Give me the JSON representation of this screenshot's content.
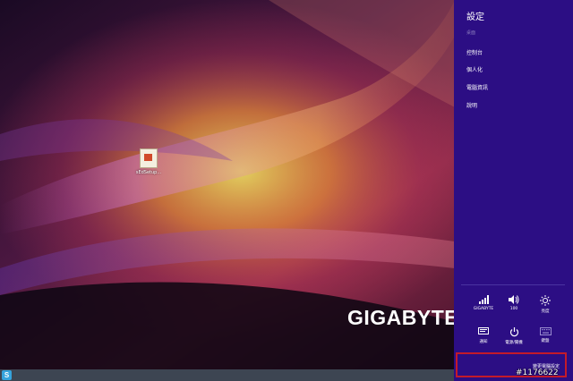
{
  "desktop": {
    "icon_label": "sEdSetup...",
    "brand": "GIGABYTE"
  },
  "charms": {
    "title": "設定",
    "subtitle": "桌面",
    "items": [
      {
        "label": "控制台"
      },
      {
        "label": "個人化"
      },
      {
        "label": "電腦資訊"
      },
      {
        "label": "說明"
      }
    ],
    "quick_settings": [
      {
        "label": "GIGABYTE",
        "icon": "wifi-signal-icon"
      },
      {
        "label": "100",
        "icon": "speaker-volume-icon"
      },
      {
        "label": "亮度",
        "icon": "brightness-sun-icon"
      },
      {
        "label": "通知",
        "icon": "notifications-icon"
      },
      {
        "label": "電源/關機",
        "icon": "power-icon"
      },
      {
        "label": "鍵盤",
        "icon": "keyboard-icon"
      }
    ],
    "change_settings_label": "變更電腦設定"
  },
  "watermark": "#1176622"
}
